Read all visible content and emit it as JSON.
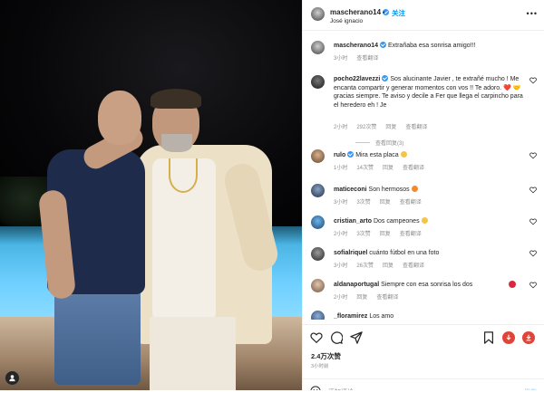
{
  "post": {
    "username": "mascherano14",
    "follow_label": "关注",
    "location": "José ignacio",
    "caption": "Extrañaba esa sonrisa amigo!!!",
    "caption_time": "3小时",
    "see_translation": "查看翻译",
    "likes": "2.4万次赞",
    "time_ago": "3小时前",
    "comment_placeholder": "添加评论......",
    "post_label": "发布"
  },
  "comments": [
    {
      "user": "pocho22lavezzi",
      "verified": true,
      "text": "Sos alucinante Javier , te extrañé mucho ! Me encanta compartir y generar momentos con vos !! Te adoro. ❤️ 🤝 gracias siempre. Te aviso y decile a Fer que llega el carpincho para el heredero eh ! Je",
      "time": "2小时",
      "likes": "292次赞",
      "reply": "回复",
      "translate": "查看翻译",
      "view_replies": "查看回复(3)"
    },
    {
      "user": "rulo",
      "verified": true,
      "text": "Mira esta placa",
      "time": "1小时",
      "likes": "14次赞",
      "reply": "回复",
      "translate": "查看翻译"
    },
    {
      "user": "maticeconi",
      "verified": false,
      "text": "Son hermosos",
      "time": "3小时",
      "likes": "3次赞",
      "reply": "回复",
      "translate": "查看翻译"
    },
    {
      "user": "cristian_arto",
      "verified": false,
      "text": "Dos campeones",
      "time": "2小时",
      "likes": "3次赞",
      "reply": "回复",
      "translate": "查看翻译"
    },
    {
      "user": "sofialriquel",
      "verified": false,
      "text": "cuánto fútbol en una foto",
      "time": "3小时",
      "likes": "26次赞",
      "reply": "回复",
      "translate": "查看翻译"
    },
    {
      "user": "aldanaportugal",
      "verified": false,
      "text": "Siempre con esa sonrisa los dos",
      "time": "2小时",
      "likes": "",
      "reply": "回复",
      "translate": "查看翻译"
    },
    {
      "user": "_floramirez",
      "verified": false,
      "text": "Los amo",
      "time": "",
      "likes": "",
      "reply": "",
      "translate": ""
    }
  ],
  "colors": {
    "link": "#0095f6",
    "muted": "#8e8e8e",
    "verified": "#3897f0",
    "red_button": "#e0453a"
  },
  "icons": [
    "heart-icon",
    "comment-icon",
    "share-icon",
    "save-icon",
    "download-icon",
    "emoji-icon",
    "more-icon",
    "user-tag-icon"
  ]
}
